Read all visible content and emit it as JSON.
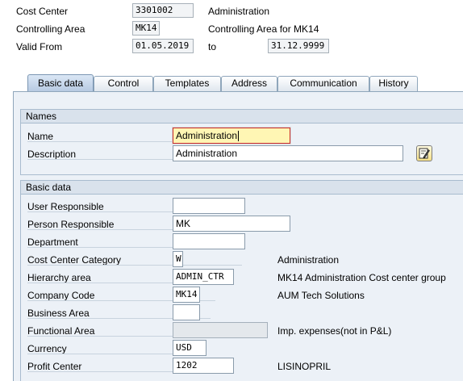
{
  "header": {
    "cost_center_label": "Cost Center",
    "cost_center_value": "3301002",
    "cost_center_text": "Administration",
    "controlling_area_label": "Controlling Area",
    "controlling_area_value": "MK14",
    "controlling_area_text": "Controlling Area for MK14",
    "valid_from_label": "Valid From",
    "valid_from_value": "01.05.2019",
    "to_label": "to",
    "valid_to_value": "31.12.9999"
  },
  "tabs": [
    {
      "label": "Basic data",
      "active": true
    },
    {
      "label": "Control",
      "active": false
    },
    {
      "label": "Templates",
      "active": false
    },
    {
      "label": "Address",
      "active": false
    },
    {
      "label": "Communication",
      "active": false
    },
    {
      "label": "History",
      "active": false
    }
  ],
  "names_group": {
    "title": "Names",
    "name_label": "Name",
    "name_value": "Administration",
    "description_label": "Description",
    "description_value": "Administration",
    "edit_icon": "edit-long-text-icon"
  },
  "basic_group": {
    "title": "Basic data",
    "user_responsible_label": "User Responsible",
    "user_responsible_value": "",
    "person_responsible_label": "Person Responsible",
    "person_responsible_value": "MK",
    "department_label": "Department",
    "department_value": "",
    "category_label": "Cost Center Category",
    "category_value": "W",
    "category_text": "Administration",
    "hierarchy_label": "Hierarchy area",
    "hierarchy_value": "ADMIN_CTR",
    "hierarchy_text": "MK14 Administration Cost center group",
    "company_code_label": "Company Code",
    "company_code_value": "MK14",
    "company_code_text": "AUM Tech Solutions",
    "business_area_label": "Business Area",
    "business_area_value": "",
    "functional_area_label": "Functional Area",
    "functional_area_value": "",
    "functional_area_text": "Imp. expenses(not in P&L)",
    "currency_label": "Currency",
    "currency_value": "USD",
    "profit_center_label": "Profit Center",
    "profit_center_value": "1202",
    "profit_center_text": "LISINOPRIL"
  },
  "colors": {
    "panel_bg": "#ecf1f7",
    "focus_field_bg": "#fff6b4",
    "focus_border": "#c92d2d"
  }
}
